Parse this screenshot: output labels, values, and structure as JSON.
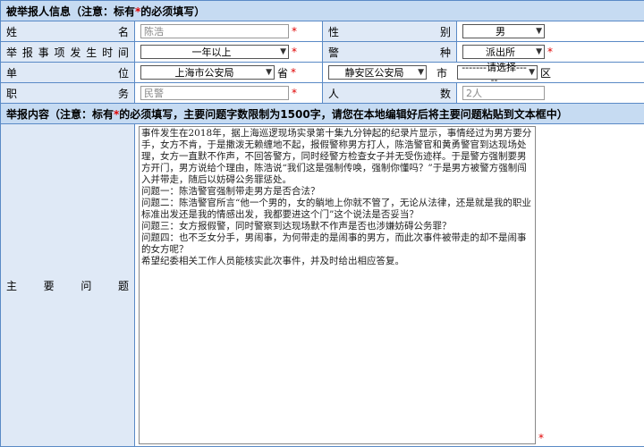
{
  "section1": {
    "title_pre": "被举报人信息（注意：标有",
    "star": "*",
    "title_post": "的必须填写）"
  },
  "rows": {
    "name_label": [
      "姓",
      "名"
    ],
    "name_value": "陈浩",
    "gender_label": [
      "性",
      "别"
    ],
    "gender_value": "男",
    "time_label": [
      "举",
      "报",
      "事",
      "项",
      "发",
      "生",
      "时",
      "间"
    ],
    "time_value": "一年以上",
    "police_label": [
      "警",
      "种"
    ],
    "police_value": "派出所",
    "unit_label": [
      "单",
      "位"
    ],
    "unit_city": "上海市公安局",
    "unit_province_suffix": "省",
    "unit_district": "静安区公安局",
    "unit_city_suffix": "市",
    "unit_area": "-------请选择-----",
    "unit_area_suffix": "区",
    "job_label": [
      "职",
      "务"
    ],
    "job_value": "民警",
    "count_label": [
      "人",
      "数"
    ],
    "count_value": "2人"
  },
  "section2": {
    "title_pre": "举报内容（注意：标有",
    "star": "*",
    "title_post": "的必须填写，主要问题字数限制为1500字，请您在本地编辑好后将主要问题粘贴到文本框中）"
  },
  "content": {
    "label": [
      "主",
      "要",
      "问",
      "题"
    ],
    "text": "事件发生在2018年，据上海巡逻现场实录第十集九分钟起的纪录片显示，事情经过为男方要分手，女方不肯，于是撒泼无赖缠地不起，报假警称男方打人，陈浩警官和黄勇警官到达现场处理，女方一直默不作声，不回答警方，同时经警方检查女子并无受伤迹样。于是警方强制要男方开门，男方说给个理由，陈浩说“我们这是强制传唤，强制你懂吗？”于是男方被警方强制闯入并带走，随后以妨碍公务罪惩处。\n问题一：陈浩警官强制带走男方是否合法？\n问题二：陈浩警官所言“他一个男的，女的躺地上你就不管了，无论从法律，还是就是我的职业标准出发还是我的情感出发，我都要进这个门”这个说法是否妥当？\n问题三：女方报假警，同时警察到达现场默不作声是否也涉嫌妨碍公务罪？\n问题四：也不乏女分手，男闹事，为何带走的是闹事的男方，而此次事件被带走的却不是闹事的女方呢？\n希望纪委相关工作人员能核实此次事件，并及时给出相应答复。"
  },
  "required_star": "*"
}
